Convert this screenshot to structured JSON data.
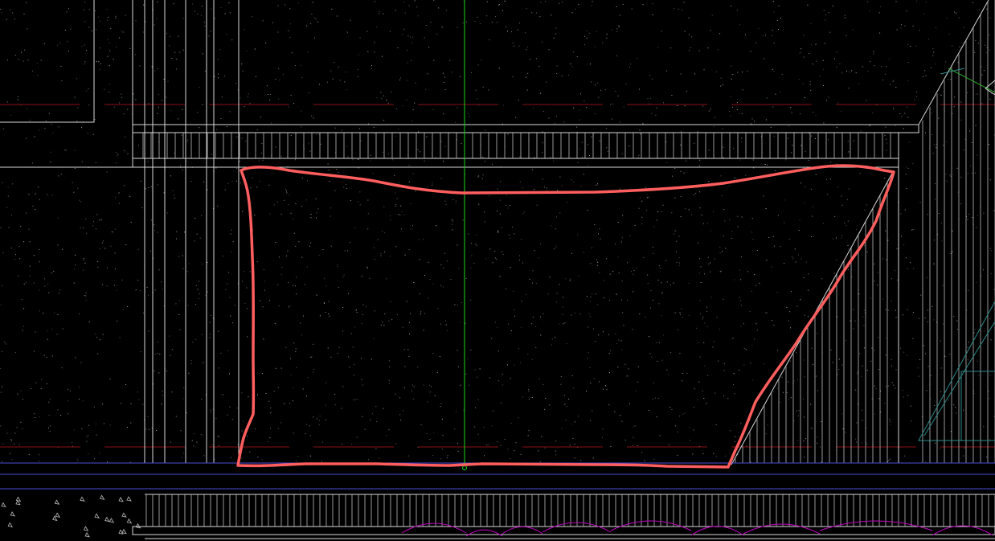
{
  "view": {
    "type": "cad-drawing",
    "background": "#000000",
    "colors": {
      "line": "#d8d8d8",
      "hatch": "#bdbdbd",
      "hidden": "#8a0f16",
      "cursor": "#1ed61e",
      "boundary": "#4d4bd6",
      "annotation": "#ff5e5e",
      "cloud": "#c400c4",
      "accent": "#2e8a8a",
      "speckle": "#cfcfcf"
    }
  }
}
